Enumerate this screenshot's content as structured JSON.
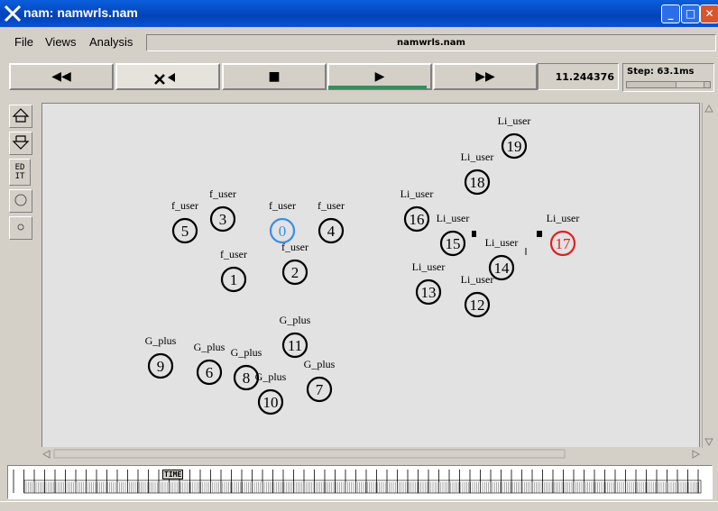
{
  "window": {
    "title": "nam: namwrls.nam",
    "buttons": [
      "_",
      "□",
      "✕"
    ]
  },
  "menu": {
    "items": [
      "File",
      "Views",
      "Analysis"
    ]
  },
  "file_name": "namwrls.nam",
  "controls": {
    "rewind": "◀◀",
    "back": "◀",
    "stop": "■",
    "play": "▶",
    "forward": "▶▶"
  },
  "time": "11.244376",
  "step": "Step: 63.1ms",
  "step_level": 0.75,
  "tools": [
    "zoom-in-icon",
    "zoom-out-icon",
    "EDIT",
    "circle-icon",
    "small-circle-icon"
  ],
  "edit_label": "ED\nIT",
  "timeline_marker": "TIME",
  "nodes": [
    {
      "id": "0",
      "label": "f_user",
      "color": "#3a8ee6"
    },
    {
      "id": "1",
      "label": "f_user",
      "color": "#000000"
    },
    {
      "id": "2",
      "label": "f_user",
      "color": "#000000"
    },
    {
      "id": "3",
      "label": "f_user",
      "color": "#000000"
    },
    {
      "id": "4",
      "label": "f_user",
      "color": "#000000"
    },
    {
      "id": "5",
      "label": "f_user",
      "color": "#000000"
    },
    {
      "id": "6",
      "label": "G_plus",
      "color": "#000000"
    },
    {
      "id": "7",
      "label": "G_plus",
      "color": "#000000"
    },
    {
      "id": "8",
      "label": "G_plus",
      "color": "#000000"
    },
    {
      "id": "9",
      "label": "G_plus",
      "color": "#000000"
    },
    {
      "id": "10",
      "label": "G_plus",
      "color": "#000000"
    },
    {
      "id": "11",
      "label": "G_plus",
      "color": "#000000"
    },
    {
      "id": "12",
      "label": "Li_user",
      "color": "#000000"
    },
    {
      "id": "13",
      "label": "Li_user",
      "color": "#000000"
    },
    {
      "id": "14",
      "label": "Li_user",
      "color": "#000000"
    },
    {
      "id": "15",
      "label": "Li_user",
      "color": "#000000"
    },
    {
      "id": "16",
      "label": "Li_user",
      "color": "#000000"
    },
    {
      "id": "17",
      "label": "Li_user",
      "color": "#e02020"
    },
    {
      "id": "18",
      "label": "Li_user",
      "color": "#000000"
    },
    {
      "id": "19",
      "label": "Li_user",
      "color": "#000000"
    }
  ]
}
